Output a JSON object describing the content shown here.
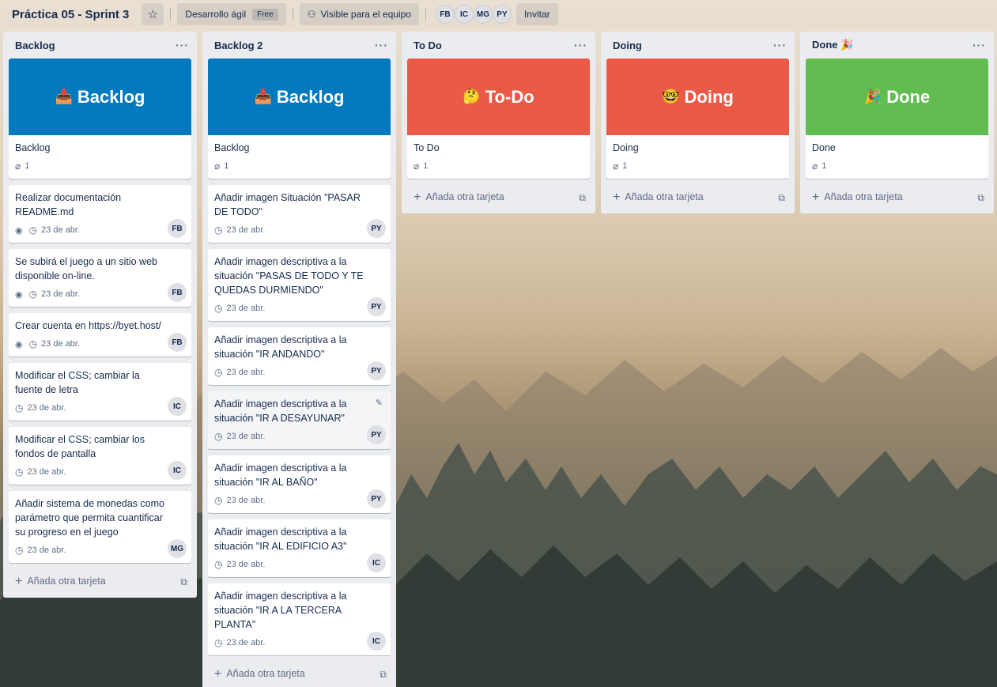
{
  "header": {
    "board_title": "Práctica 05 - Sprint 3",
    "workspace_label": "Desarrollo ágil",
    "plan_badge": "Free",
    "visibility_label": "Visible para el equipo",
    "members": [
      "FB",
      "IC",
      "MG",
      "PY"
    ],
    "invite_label": "Invitar"
  },
  "lists": [
    {
      "name": "Backlog",
      "add_label": "Añada otra tarjeta",
      "cards": [
        {
          "cover_text": "Backlog",
          "cover_emoji": "📥",
          "cover_color": "#0079bf",
          "title": "Backlog",
          "attachments": "1"
        },
        {
          "title": "Realizar documentación README.md",
          "date": "23 de abr.",
          "watching": true,
          "member": "FB"
        },
        {
          "title": "Se subirá el juego a un sitio web disponible on-line.",
          "date": "23 de abr.",
          "watching": true,
          "member": "FB"
        },
        {
          "title": "Crear cuenta en https://byet.host/",
          "date": "23 de abr.",
          "watching": true,
          "member": "FB"
        },
        {
          "title": "Modificar el CSS; cambiar la fuente de letra",
          "date": "23 de abr.",
          "member": "IC"
        },
        {
          "title": "Modificar el CSS; cambiar los fondos de pantalla",
          "date": "23 de abr.",
          "member": "IC"
        },
        {
          "title": "Añadir sistema de monedas como parámetro que permita cuantificar su progreso en el juego",
          "date": "23 de abr.",
          "member": "MG"
        }
      ]
    },
    {
      "name": "Backlog 2",
      "add_label": "Añada otra tarjeta",
      "cards": [
        {
          "cover_text": "Backlog",
          "cover_emoji": "📥",
          "cover_color": "#0079bf",
          "title": "Backlog",
          "attachments": "1"
        },
        {
          "title": "Añadir imagen Situación \"PASAR DE TODO\"",
          "date": "23 de abr.",
          "member": "PY"
        },
        {
          "title": "Añadir imagen descriptiva a la situación \"PASAS DE TODO Y TE QUEDAS DURMIENDO\"",
          "date": "23 de abr.",
          "member": "PY"
        },
        {
          "title": "Añadir imagen descriptiva a la situación \"IR ANDANDO\"",
          "date": "23 de abr.",
          "member": "PY"
        },
        {
          "title": "Añadir imagen descriptiva a la situación \"IR A DESAYUNAR\"",
          "date": "23 de abr.",
          "member": "PY",
          "hover": true
        },
        {
          "title": "Añadir imagen descriptiva a la situación \"IR AL BAÑO\"",
          "date": "23 de abr.",
          "member": "PY"
        },
        {
          "title": "Añadir imagen descriptiva a la situación \"IR AL EDIFICIO A3\"",
          "date": "23 de abr.",
          "member": "IC"
        },
        {
          "title": "Añadir imagen descriptiva a la situación \"IR A LA TERCERA PLANTA\"",
          "date": "23 de abr.",
          "member": "IC"
        }
      ]
    },
    {
      "name": "To Do",
      "add_label": "Añada otra tarjeta",
      "cards": [
        {
          "cover_text": "To-Do",
          "cover_emoji": "🤔",
          "cover_color": "#eb5a46",
          "title": "To Do",
          "attachments": "1"
        }
      ]
    },
    {
      "name": "Doing",
      "add_label": "Añada otra tarjeta",
      "cards": [
        {
          "cover_text": "Doing",
          "cover_emoji": "🤓",
          "cover_color": "#eb5a46",
          "title": "Doing",
          "attachments": "1"
        }
      ]
    },
    {
      "name": "Done 🎉",
      "add_label": "Añada otra tarjeta",
      "cards": [
        {
          "cover_text": "Done",
          "cover_emoji": "🎉",
          "cover_color": "#61bd4f",
          "title": "Done",
          "attachments": "1"
        }
      ]
    }
  ]
}
